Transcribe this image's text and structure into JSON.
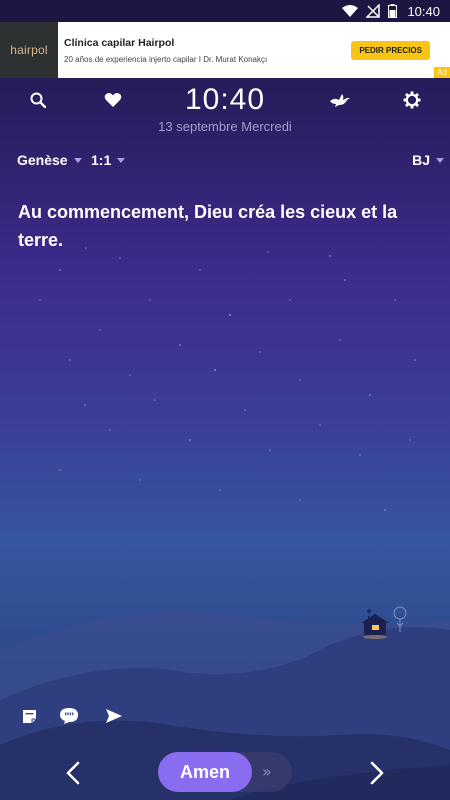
{
  "status_bar": {
    "time": "10:40",
    "icons": [
      "wifi-icon",
      "no-signal-icon",
      "battery-icon"
    ]
  },
  "ad": {
    "logo_text": "hairpol",
    "title": "Clínica capilar Hairpol",
    "description": "20 años de experiencia injerto capilar I Dr. Murat Konakçı",
    "cta": "PEDIR PRECIOS",
    "badge": "Ad",
    "colors": {
      "cta": "#f9c514",
      "logo_bg": "#2e3131"
    }
  },
  "header": {
    "time": "10:40",
    "date": "13 septembre Mercredi",
    "icons": [
      "search-icon",
      "heart-icon",
      "dove-icon",
      "gear-icon"
    ]
  },
  "selectors": {
    "book": "Genèse",
    "chapter_verse": "1:1",
    "version": "BJ"
  },
  "verse": {
    "text": "Au commencement, Dieu créa les cieux et la terre."
  },
  "tools": {
    "icons": [
      "note-icon",
      "quote-icon",
      "send-icon"
    ]
  },
  "bottom": {
    "amen_label": "Amen",
    "slide_hint": "»",
    "icons": [
      "chevron-left-icon",
      "chevron-right-icon"
    ]
  },
  "colors": {
    "accent": "#8a6cf0",
    "caret": "#a99fe6",
    "date_text": "#a39ccc"
  }
}
